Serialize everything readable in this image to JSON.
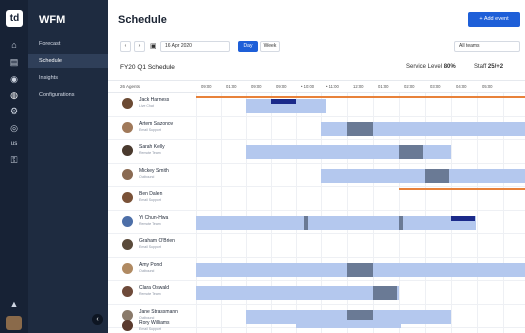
{
  "logo": "td",
  "app_title": "WFM",
  "nav_items": [
    "Forecast",
    "Schedule",
    "Insights",
    "Configurations"
  ],
  "header": {
    "title": "Schedule",
    "add_event": "+ Add event"
  },
  "toolbar": {
    "prev": "‹",
    "next": "›",
    "date": "16 Apr 2020",
    "day": "Day",
    "week": "Week",
    "teams": "All teams"
  },
  "schedule": {
    "name": "FY20 Q1 Schedule",
    "service_level_label": "Service Level",
    "service_level_value": "80%",
    "staff_label": "Staff",
    "staff_value": "25/+2"
  },
  "grid": {
    "agents_label": "26 Agents",
    "hours": [
      "09:00",
      "01:00",
      "09:00",
      "09:00",
      "• 10:00",
      "• 11:00",
      "12:00",
      "01:00",
      "02:00",
      "03:00",
      "04:00",
      "05:00"
    ]
  },
  "agents": [
    {
      "name": "Jack Harness",
      "team": "Live Chat",
      "avatar": "#6b4a33"
    },
    {
      "name": "Artem Sazonov",
      "team": "Email Support",
      "avatar": "#a0795a"
    },
    {
      "name": "Sarah Kelly",
      "team": "Remote Team",
      "avatar": "#4a3a2e"
    },
    {
      "name": "Mickey Smith",
      "team": "Outbound",
      "avatar": "#8a6a52"
    },
    {
      "name": "Ben Dalen",
      "team": "Email Support",
      "avatar": "#7a5238"
    },
    {
      "name": "Yi Chun-Hwa",
      "team": "Remote Team",
      "avatar": "#4d6fa8"
    },
    {
      "name": "Graham O'Brien",
      "team": "Email Support",
      "avatar": "#5a4a3a"
    },
    {
      "name": "Amy Pond",
      "team": "Outbound",
      "avatar": "#b08a62"
    },
    {
      "name": "Clara Oswald",
      "team": "Remote Team",
      "avatar": "#6e4a3a"
    },
    {
      "name": "Jane Strassmann",
      "team": "Outbound",
      "avatar": "#8a7a6a"
    },
    {
      "name": "Rory Williams",
      "team": "Email Support",
      "avatar": "#5a3a2e"
    }
  ]
}
